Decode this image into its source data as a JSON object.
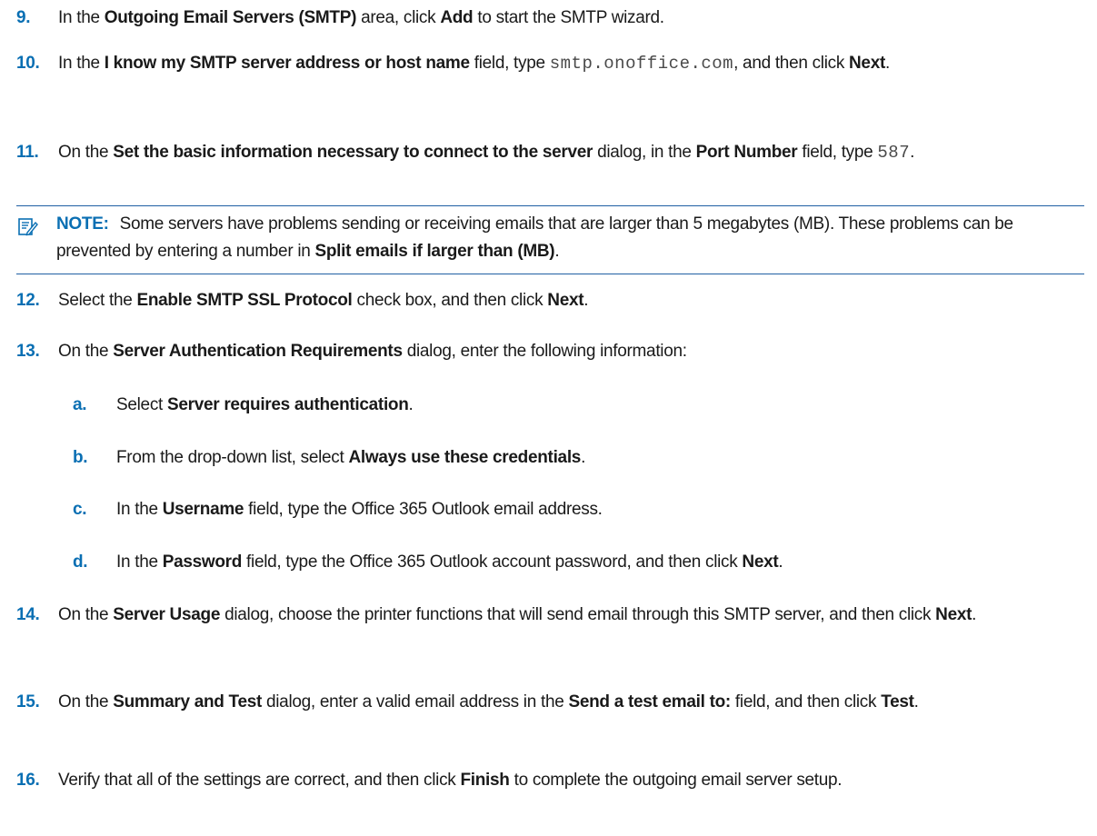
{
  "steps": [
    {
      "num": "9.",
      "t1": "In the ",
      "b1": "Outgoing Email Servers (SMTP)",
      "t2": " area, click ",
      "b2": "Add",
      "t3": " to start the SMTP wizard."
    },
    {
      "num": "10.",
      "t1": "In the ",
      "b1": "I know my SMTP server address or host name",
      "t2": " field, type ",
      "code": "smtp.onoffice.com",
      "t3": ", and then click ",
      "b2": "Next",
      "t4": "."
    },
    {
      "num": "11.",
      "t1": "On the ",
      "b1": "Set the basic information necessary to connect to the server",
      "t2": " dialog, in the ",
      "b2": "Port Number",
      "t3": " field, type ",
      "code": "587",
      "t4": "."
    },
    {
      "num": "12.",
      "t1": "Select the ",
      "b1": "Enable SMTP SSL Protocol",
      "t2": " check box, and then click ",
      "b2": "Next",
      "t3": "."
    },
    {
      "num": "13.",
      "t1": "On the ",
      "b1": "Server Authentication Requirements",
      "t2": " dialog, enter the following information:"
    },
    {
      "num": "14.",
      "t1": "On the ",
      "b1": "Server Usage",
      "t2": " dialog, choose the printer functions that will send email through this SMTP server, and then click ",
      "b2": "Next",
      "t3": "."
    },
    {
      "num": "15.",
      "t1": "On the ",
      "b1": "Summary and Test",
      "t2": " dialog, enter a valid email address in the ",
      "b2": "Send a test email to:",
      "t3": " field, and then click ",
      "b3": "Test",
      "t4": "."
    },
    {
      "num": "16.",
      "t1": "Verify that all of the settings are correct, and then click ",
      "b1": "Finish",
      "t2": " to complete the outgoing email server setup."
    }
  ],
  "substeps": [
    {
      "num": "a.",
      "t1": "Select ",
      "b1": "Server requires authentication",
      "t2": "."
    },
    {
      "num": "b.",
      "t1": "From the drop-down list, select ",
      "b1": "Always use these credentials",
      "t2": "."
    },
    {
      "num": "c.",
      "t1": "In the ",
      "b1": "Username",
      "t2": " field, type the Office 365 Outlook email address."
    },
    {
      "num": "d.",
      "t1": "In the ",
      "b1": "Password",
      "t2": " field, type the Office 365 Outlook account password, and then click ",
      "b2": "Next",
      "t3": "."
    }
  ],
  "note": {
    "icon": "note-icon",
    "label": "NOTE:",
    "t1": "Some servers have problems sending or receiving emails that are larger than 5 megabytes (MB). These problems can be prevented by entering a number in ",
    "b1": "Split emails if larger than (MB)",
    "t2": "."
  }
}
